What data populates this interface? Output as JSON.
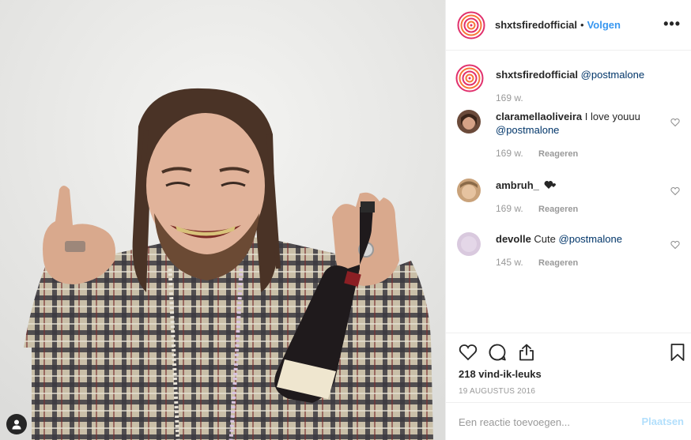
{
  "post": {
    "photo_alt": "",
    "author": "shxtsfiredofficial",
    "separator": "•",
    "follow_label": "Volgen",
    "more_icon": "more-horizontal-icon",
    "caption": {
      "user": "shxtsfiredofficial",
      "text": "@postmalone",
      "time": "169 w."
    },
    "comments": [
      {
        "user": "claramellaoliveira",
        "text": "I love youuu",
        "mention": "@postmalone",
        "time": "169 w.",
        "reply_label": "Reageren",
        "avatar_color": "#6b4a3a"
      },
      {
        "user": "ambruh_",
        "text": "",
        "emoji": "black-heart-icon",
        "mention": "",
        "time": "169 w.",
        "reply_label": "Reageren",
        "avatar_color": "#c9a27a"
      },
      {
        "user": "devolle",
        "text": "Cute",
        "mention": "@postmalone",
        "time": "145 w.",
        "reply_label": "Reageren",
        "avatar_color": "#d9c9de"
      }
    ],
    "likes": "218 vind-ik-leuks",
    "date": "19 AUGUSTUS 2016",
    "comment_placeholder": "Een reactie toevoegen...",
    "post_label": "Plaatsen"
  },
  "colors": {
    "accent": "#3897f0",
    "mention": "#003569",
    "muted": "#999999",
    "post_disabled": "#b2dffc"
  }
}
